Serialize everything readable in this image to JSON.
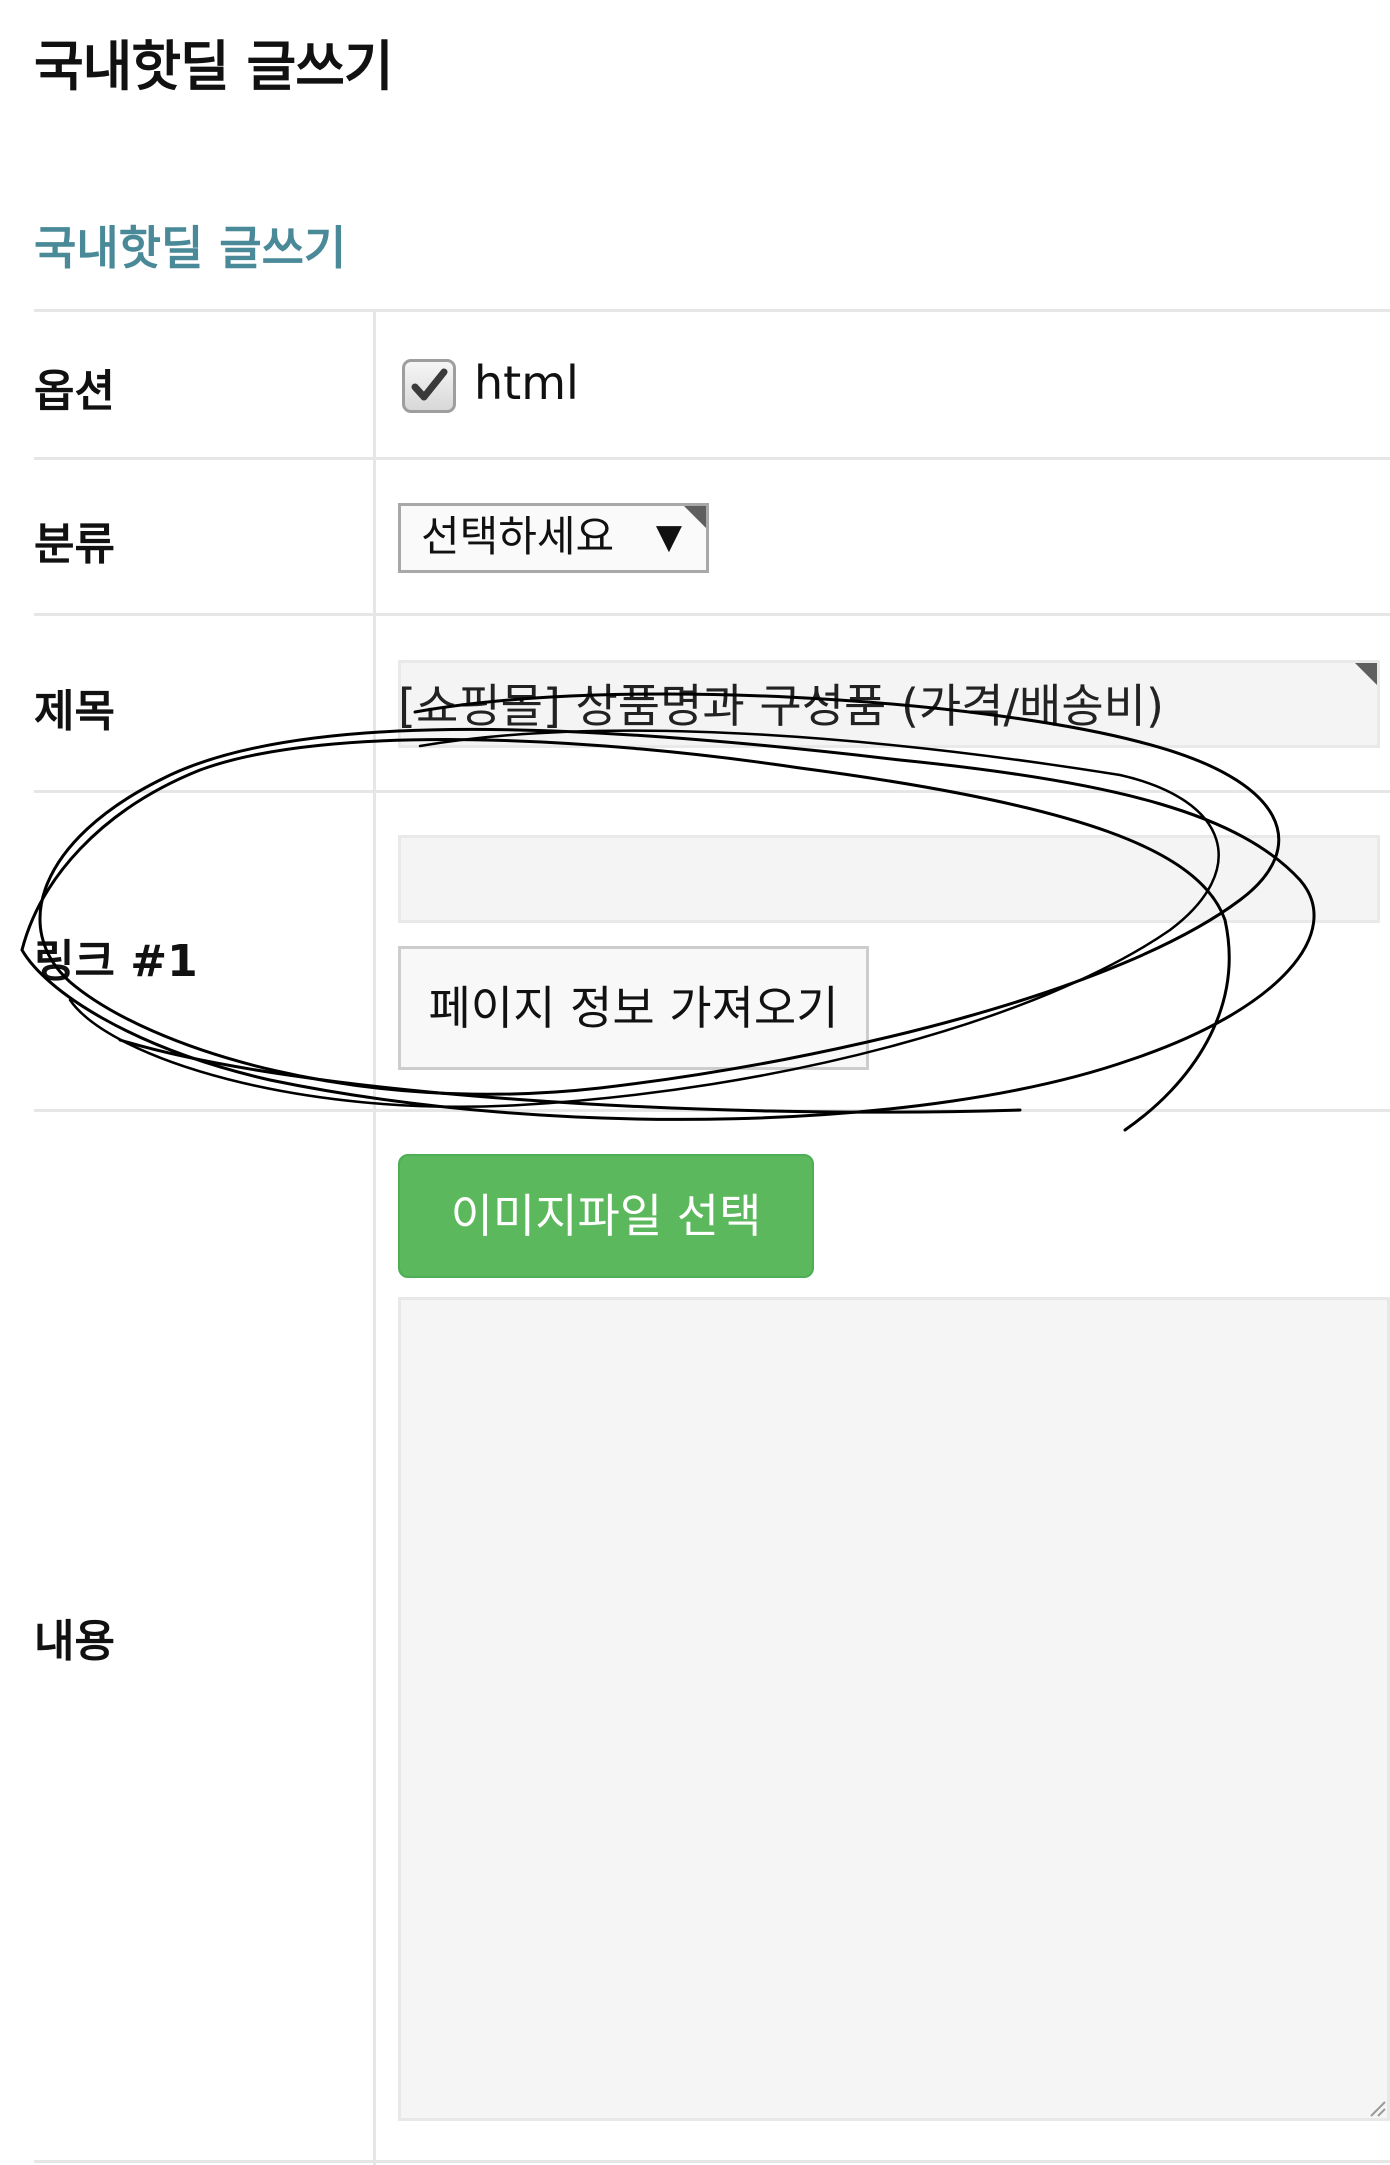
{
  "page": {
    "title": "국내핫딜 글쓰기"
  },
  "form": {
    "section_title": "국내핫딜 글쓰기",
    "options": {
      "label": "옵션",
      "html_checkbox_label": "html",
      "html_checked": true
    },
    "category": {
      "label": "분류",
      "selected": "선택하세요",
      "caret": "▼"
    },
    "subject": {
      "label": "제목",
      "placeholder": "[쇼핑몰] 상품명과 구성품 (가격/배송비)"
    },
    "link": {
      "label": "링크 #1",
      "value": "",
      "fetch_button": "페이지 정보 가져오기"
    },
    "content": {
      "label": "내용",
      "image_button": "이미지파일 선택",
      "value": ""
    }
  },
  "icons": {
    "checkbox": "checkmark-icon",
    "corner": "corner-marker-icon",
    "resize": "resize-grip-icon"
  },
  "colors": {
    "section_title": "#4a8a98",
    "image_button": "#5cb85c",
    "field_background": "#f4f4f4",
    "divider": "#e6e6e6"
  }
}
